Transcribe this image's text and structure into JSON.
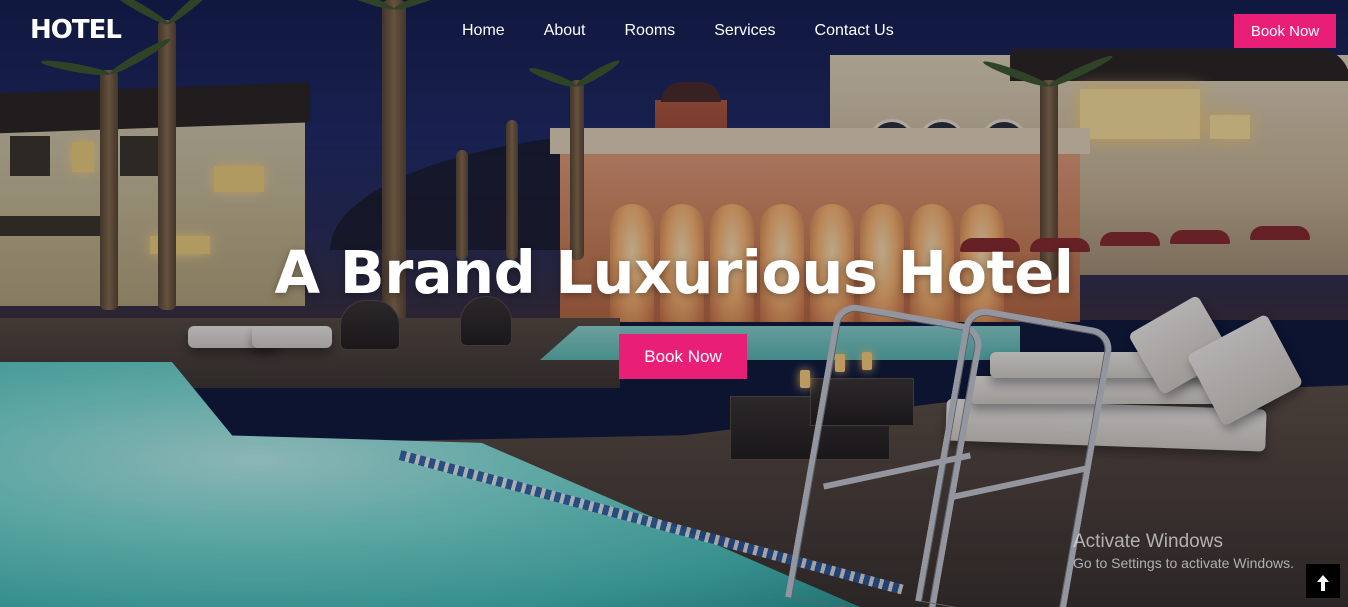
{
  "header": {
    "logo_text": "HOTEL",
    "nav": [
      "Home",
      "About",
      "Rooms",
      "Services",
      "Contact Us"
    ],
    "book_button": "Book Now"
  },
  "hero": {
    "title": "A Brand Luxurious Hotel",
    "book_button": "Book Now",
    "background": "night-resort-pool-scene"
  },
  "watermark": {
    "line1": "Activate Windows",
    "line2": "Go to Settings to activate Windows."
  },
  "scroll_top": {
    "icon": "arrow-up-icon",
    "glyph": "🡑"
  },
  "colors": {
    "accent": "#e91e76",
    "text": "#ffffff",
    "scroll_top_bg": "#000000"
  }
}
